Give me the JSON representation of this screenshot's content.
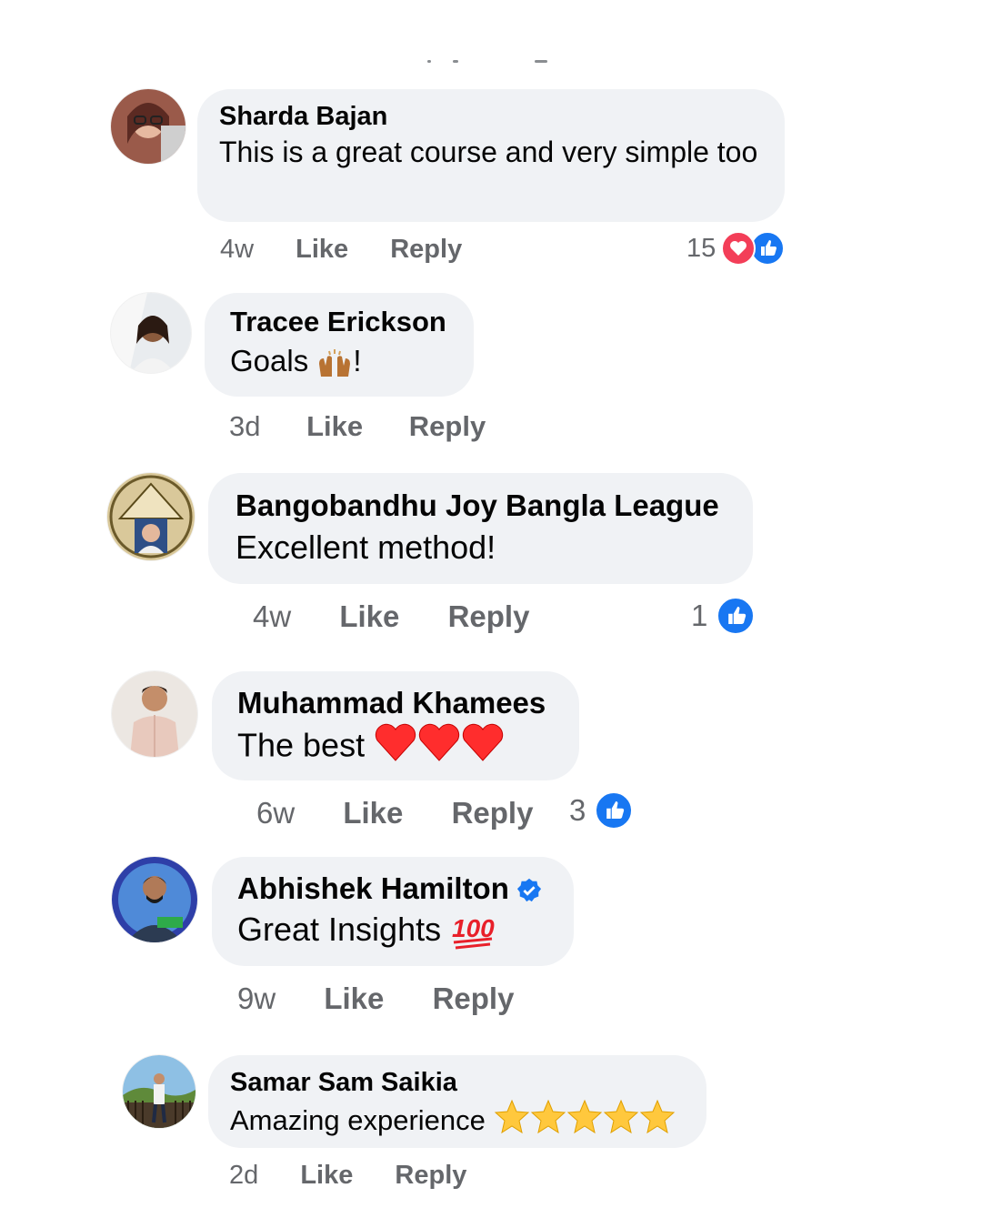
{
  "comments": [
    {
      "author": "Sharda Bajan",
      "text": "This is a great course and very simple too",
      "time": "4w",
      "like_label": "Like",
      "reply_label": "Reply",
      "reaction_count": "15",
      "reactions": [
        "heart-icon",
        "like-icon"
      ]
    },
    {
      "author": "Tracee Erickson",
      "text": "Goals",
      "text_suffix": "!",
      "emoji": "raising-hands-emoji",
      "time": "3d",
      "like_label": "Like",
      "reply_label": "Reply"
    },
    {
      "author": "Bangobandhu Joy Bangla League",
      "text": "Excellent method!",
      "time": "4w",
      "like_label": "Like",
      "reply_label": "Reply",
      "reaction_count": "1",
      "reactions": [
        "like-icon"
      ]
    },
    {
      "author": "Muhammad Khamees",
      "text": "The best",
      "emoji": "red-heart-emoji x3",
      "time": "6w",
      "like_label": "Like",
      "reply_label": "Reply",
      "reaction_count": "3",
      "reactions": [
        "like-icon"
      ]
    },
    {
      "author": "Abhishek Hamilton",
      "verified": true,
      "text": "Great Insights",
      "emoji": "hundred-points-emoji",
      "time": "9w",
      "like_label": "Like",
      "reply_label": "Reply"
    },
    {
      "author": "Samar Sam Saikia",
      "text": "Amazing experience",
      "emoji": "star-emoji x5",
      "time": "2d",
      "like_label": "Like",
      "reply_label": "Reply"
    }
  ],
  "colors": {
    "bubble": "#f0f2f5",
    "meta_text": "#65676b",
    "like_blue": "#1877f2",
    "love_red": "#f33e58",
    "verified_blue": "#1877f2"
  }
}
